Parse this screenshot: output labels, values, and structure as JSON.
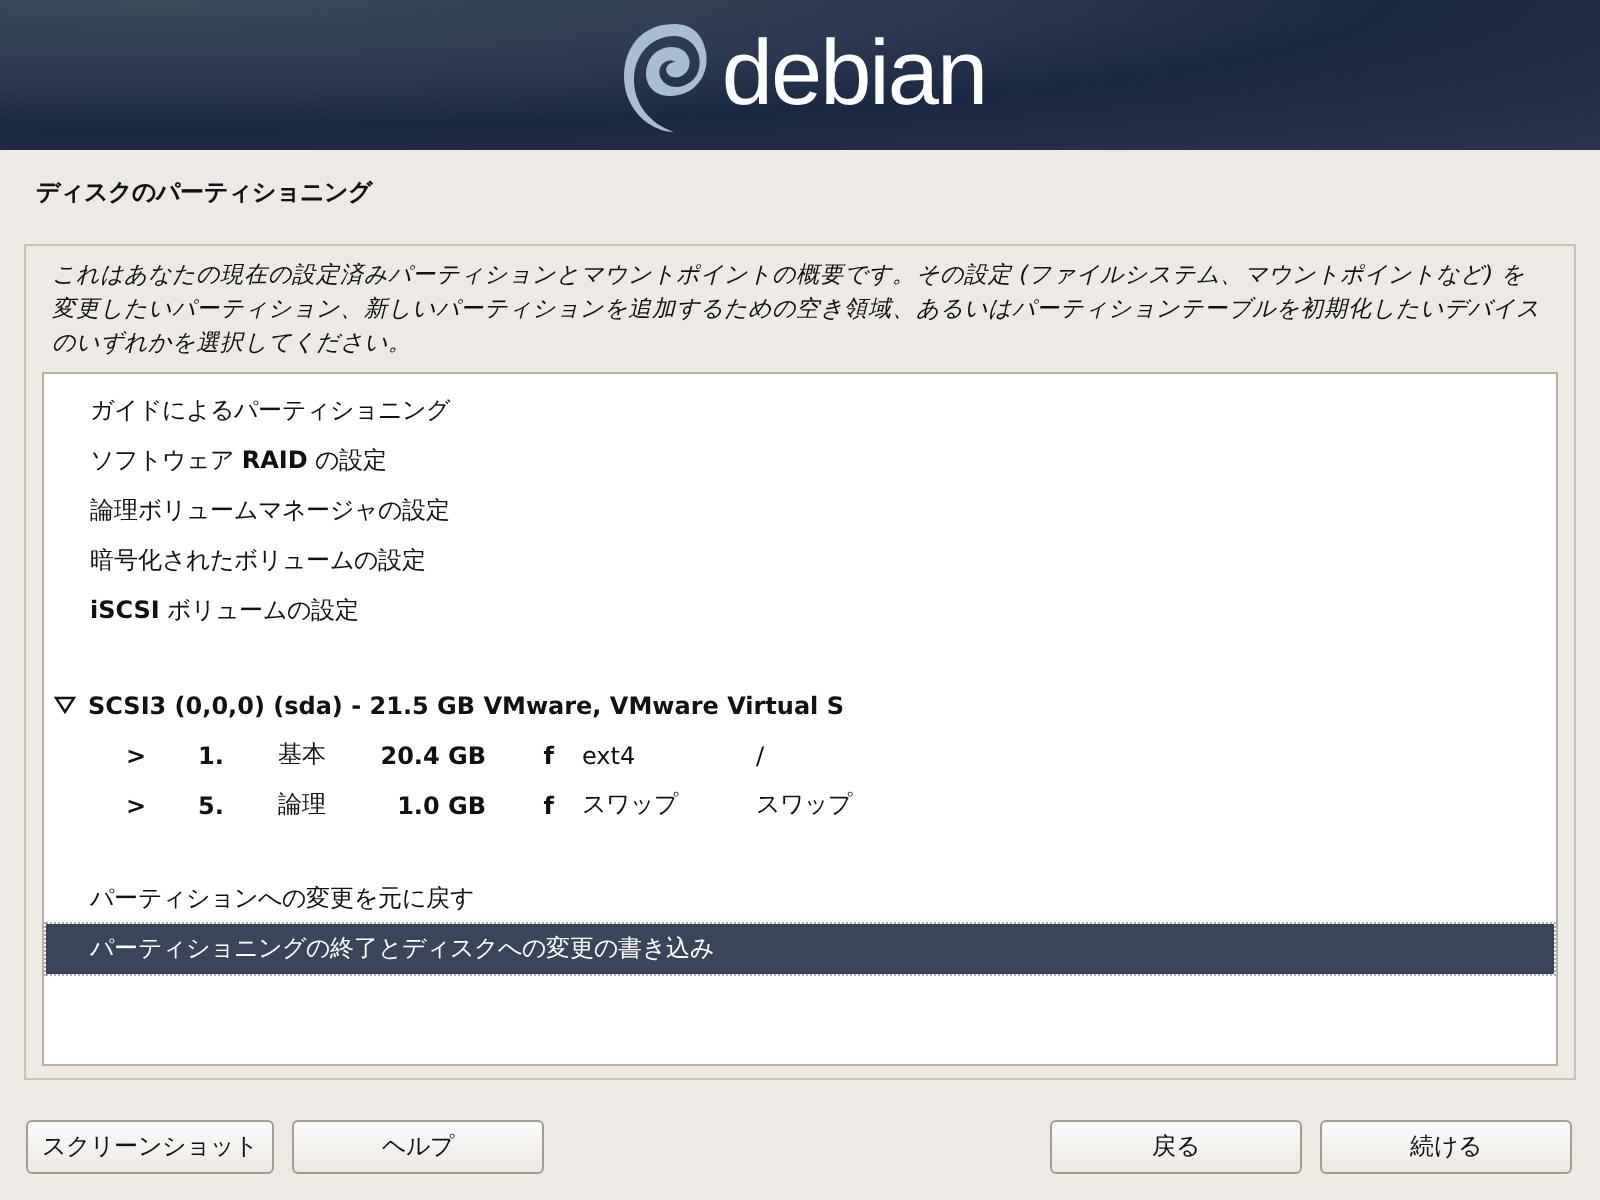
{
  "header": {
    "logo_text": "debian"
  },
  "page_title": "ディスクのパーティショニング",
  "description": "これはあなたの現在の設定済みパーティションとマウントポイントの概要です。その設定 (ファイルシステム、マウントポイントなど) を変更したいパーティション、新しいパーティションを追加するための空き領域、あるいはパーティションテーブルを初期化したいデバイスのいずれかを選択してください。",
  "sections": [
    {
      "kind": "actions",
      "items": [
        {
          "label": "ガイドによるパーティショニング",
          "selected": false
        },
        {
          "label": "ソフトウェア **RAID** の設定",
          "selected": false
        },
        {
          "label": "論理ボリュームマネージャの設定",
          "selected": false
        },
        {
          "label": "暗号化されたボリュームの設定",
          "selected": false
        },
        {
          "label": "**iSCSI** ボリュームの設定",
          "selected": false
        }
      ]
    },
    {
      "kind": "device",
      "label": "SCSI3 (0,0,0) (sda) - 21.5 GB VMware, VMware Virtual S",
      "expanded": true,
      "selected": false,
      "children": [
        {
          "marker": ">",
          "number": "1.",
          "type": "基本",
          "size": "20.4 GB",
          "flag": "f",
          "filesystem": "ext4",
          "mount": "/",
          "selected": false
        },
        {
          "marker": ">",
          "number": "5.",
          "type": "論理",
          "size": "1.0 GB",
          "flag": "f",
          "filesystem": "スワップ",
          "mount": "スワップ",
          "selected": false
        }
      ]
    },
    {
      "kind": "actions",
      "items": [
        {
          "label": "パーティションへの変更を元に戻す",
          "selected": false
        },
        {
          "label": "パーティショニングの終了とディスクへの変更の書き込み",
          "selected": true
        }
      ]
    }
  ],
  "buttons_left": [
    "スクリーンショット",
    "ヘルプ"
  ],
  "buttons_right": [
    "戻る",
    "続ける"
  ]
}
